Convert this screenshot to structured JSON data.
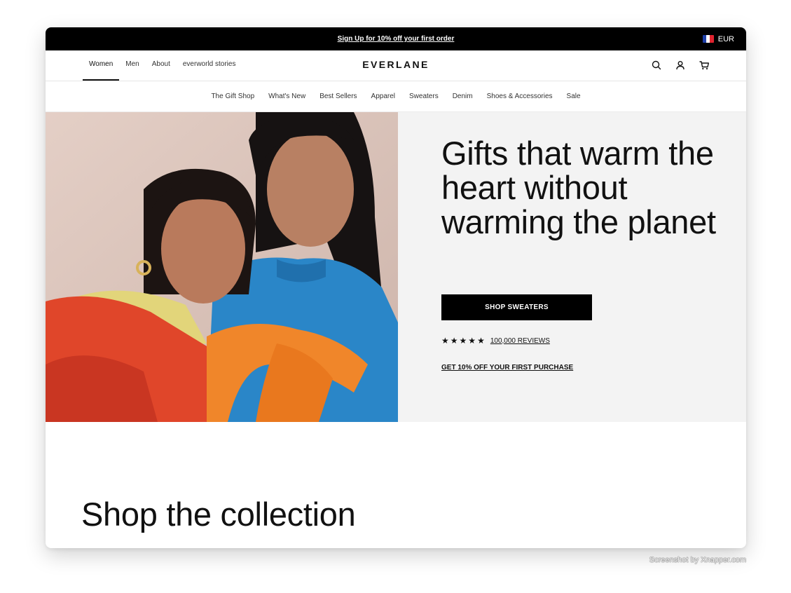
{
  "announcement": {
    "text": "Sign Up for 10% off your first order"
  },
  "currency": {
    "label": "EUR",
    "flag_colors": [
      "#1f3fa8",
      "#ffffff",
      "#e0242f"
    ]
  },
  "gender_nav": [
    {
      "label": "Women",
      "active": true
    },
    {
      "label": "Men"
    },
    {
      "label": "About"
    },
    {
      "label": "everworld stories"
    }
  ],
  "brand": {
    "logo": "EVERLANE"
  },
  "header_icons": [
    "search-icon",
    "account-icon",
    "cart-icon"
  ],
  "category_nav": [
    "The Gift Shop",
    "What's New",
    "Best Sellers",
    "Apparel",
    "Sweaters",
    "Denim",
    "Shoes & Accessories",
    "Sale"
  ],
  "hero": {
    "title": "Gifts that warm the heart without warming the planet",
    "cta": "SHOP SWEATERS",
    "rating_stars": 5,
    "reviews_link": "100,000 REVIEWS",
    "promo_link": "GET 10% OFF YOUR FIRST PURCHASE",
    "image": "Two women wearing red, orange, blue and yellow knit sweaters"
  },
  "collection": {
    "title": "Shop the collection"
  },
  "credit": "Screenshot by Xnapper.com",
  "colors": {
    "accent": "#000000",
    "hero_panel": "#f3f3f3"
  }
}
